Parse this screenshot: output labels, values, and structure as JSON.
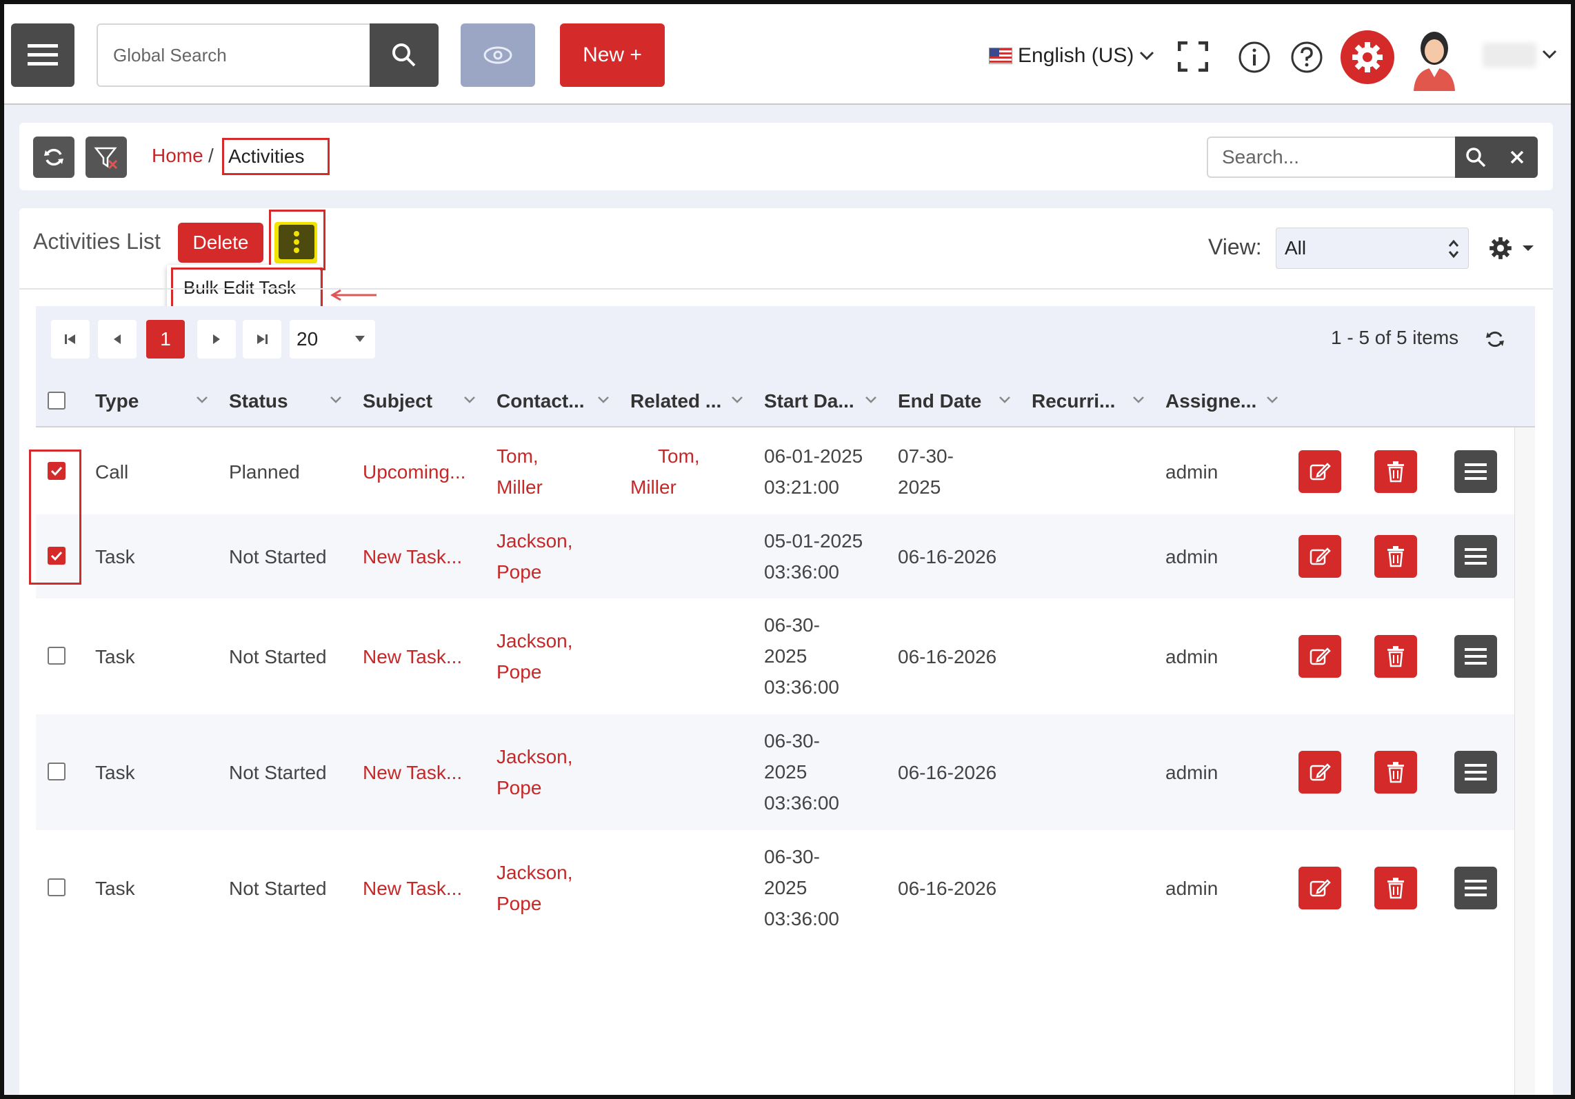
{
  "topbar": {
    "search_placeholder": "Global Search",
    "new_label": "New +",
    "language": "English (US)"
  },
  "breadcrumb": {
    "home": "Home",
    "separator": "/",
    "current": "Activities",
    "search_placeholder": "Search..."
  },
  "list": {
    "title": "Activities List",
    "delete_label": "Delete",
    "menu_item": "Bulk Edit Task",
    "view_label": "View:",
    "view_value": "All"
  },
  "pager": {
    "current_page": "1",
    "page_size": "20",
    "info": "1 - 5 of 5 items"
  },
  "columns": [
    "Type",
    "Status",
    "Subject",
    "Contact...",
    "Related ...",
    "Start Da...",
    "End Date",
    "Recurri...",
    "Assigne..."
  ],
  "rows": [
    {
      "checked": true,
      "type": "Call",
      "status": "Planned",
      "subject": "Upcoming...",
      "contact1": "Tom,",
      "contact2": "Miller",
      "related1": "Tom,",
      "related2": "Miller",
      "start1": "06-01-2025",
      "start2": "03:21:00",
      "start3": "",
      "end1": "07-30-",
      "end2": "2025",
      "assignee": "admin"
    },
    {
      "checked": true,
      "type": "Task",
      "status": "Not Started",
      "subject": "New Task...",
      "contact1": "Jackson,",
      "contact2": "Pope",
      "related1": "",
      "related2": "",
      "start1": "05-01-2025",
      "start2": "03:36:00",
      "start3": "",
      "end1": "06-16-2026",
      "end2": "",
      "assignee": "admin"
    },
    {
      "checked": false,
      "type": "Task",
      "status": "Not Started",
      "subject": "New Task...",
      "contact1": "Jackson,",
      "contact2": "Pope",
      "related1": "",
      "related2": "",
      "start1": "06-30-",
      "start2": "2025",
      "start3": "03:36:00",
      "end1": "06-16-2026",
      "end2": "",
      "assignee": "admin"
    },
    {
      "checked": false,
      "type": "Task",
      "status": "Not Started",
      "subject": "New Task...",
      "contact1": "Jackson,",
      "contact2": "Pope",
      "related1": "",
      "related2": "",
      "start1": "06-30-",
      "start2": "2025",
      "start3": "03:36:00",
      "end1": "06-16-2026",
      "end2": "",
      "assignee": "admin"
    },
    {
      "checked": false,
      "type": "Task",
      "status": "Not Started",
      "subject": "New Task...",
      "contact1": "Jackson,",
      "contact2": "Pope",
      "related1": "",
      "related2": "",
      "start1": "06-30-",
      "start2": "2025",
      "start3": "03:36:00",
      "end1": "06-16-2026",
      "end2": "",
      "assignee": "admin"
    }
  ],
  "colors": {
    "accent": "#d42a2a",
    "dark": "#4a4a4a",
    "highlight": "#f2e400"
  }
}
